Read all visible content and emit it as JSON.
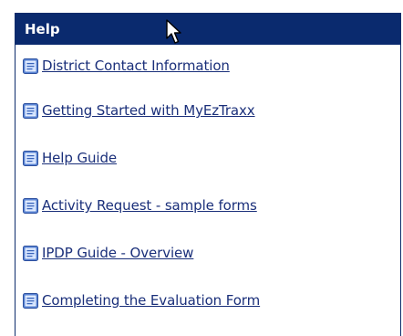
{
  "panel": {
    "title": "Help",
    "header_color": "#0a2a6e",
    "link_color": "#1a2f7a"
  },
  "links": [
    {
      "label": "District Contact Information",
      "icon": "document-icon"
    },
    {
      "label": "Getting Started with MyEzTraxx",
      "icon": "document-icon"
    },
    {
      "label": "Help Guide",
      "icon": "document-icon"
    },
    {
      "label": "Activity Request - sample forms",
      "icon": "document-icon"
    },
    {
      "label": "IPDP Guide - Overview",
      "icon": "document-icon"
    },
    {
      "label": "Completing the Evaluation Form",
      "icon": "document-icon"
    }
  ]
}
